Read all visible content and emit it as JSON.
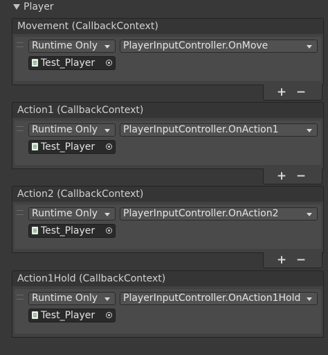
{
  "foldout": {
    "label": "Player"
  },
  "events": [
    {
      "title": "Movement (CallbackContext)",
      "mode": "Runtime Only",
      "function": "PlayerInputController.OnMove",
      "object": "Test_Player"
    },
    {
      "title": "Action1 (CallbackContext)",
      "mode": "Runtime Only",
      "function": "PlayerInputController.OnAction1",
      "object": "Test_Player"
    },
    {
      "title": "Action2 (CallbackContext)",
      "mode": "Runtime Only",
      "function": "PlayerInputController.OnAction2",
      "object": "Test_Player"
    },
    {
      "title": "Action1Hold (CallbackContext)",
      "mode": "Runtime Only",
      "function": "PlayerInputController.OnAction1Hold",
      "object": "Test_Player"
    }
  ],
  "footer": {
    "add_label": "+",
    "remove_label": "−"
  },
  "icons": {
    "foldout": "triangle-down-icon",
    "dropdown": "chevron-down-icon",
    "script": "script-icon",
    "object_picker": "target-icon"
  }
}
